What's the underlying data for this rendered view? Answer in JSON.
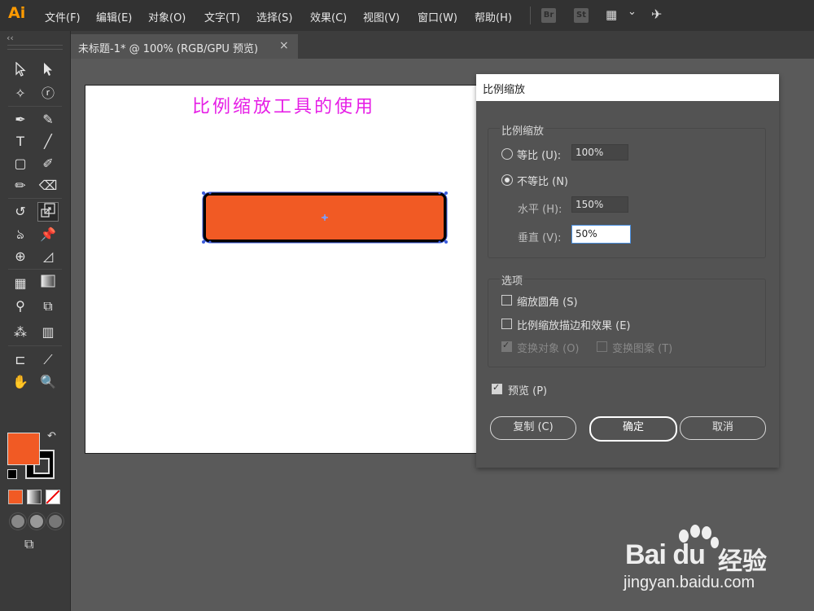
{
  "app": {
    "logo": "Ai"
  },
  "menu": [
    "文件(F)",
    "编辑(E)",
    "对象(O)",
    "文字(T)",
    "选择(S)",
    "效果(C)",
    "视图(V)",
    "窗口(W)",
    "帮助(H)"
  ],
  "menubar_icons": {
    "br": "Br",
    "st": "St",
    "workspace": "▦",
    "chevron": "⌄",
    "sync": "✈"
  },
  "document_tab": {
    "title": "未标题-1* @ 100% (RGB/GPU 预览)",
    "close": "×"
  },
  "toolbar": {
    "collapse": "‹‹"
  },
  "artboard": {
    "heading": "比例缩放工具的使用",
    "shape_fill": "#f15a24",
    "shape_stroke": "#000000",
    "selection_color": "#3b5bdb"
  },
  "dialog": {
    "title": "比例缩放",
    "scale_group": "比例缩放",
    "uniform_label": "等比 (U):",
    "uniform_value": "100%",
    "nonuniform_label": "不等比 (N)",
    "horizontal_label": "水平 (H):",
    "horizontal_value": "150%",
    "vertical_label": "垂直 (V):",
    "vertical_value": "50%",
    "options_group": "选项",
    "scale_corners": "缩放圆角 (S)",
    "scale_strokes": "比例缩放描边和效果 (E)",
    "transform_objects": "变换对象 (O)",
    "transform_patterns": "变换图案 (T)",
    "preview": "预览 (P)",
    "copy_button": "复制 (C)",
    "ok_button": "确定",
    "cancel_button": "取消"
  },
  "watermark": {
    "brand": "Bai du",
    "brand_cn": "经验",
    "url": "jingyan.baidu.com"
  }
}
